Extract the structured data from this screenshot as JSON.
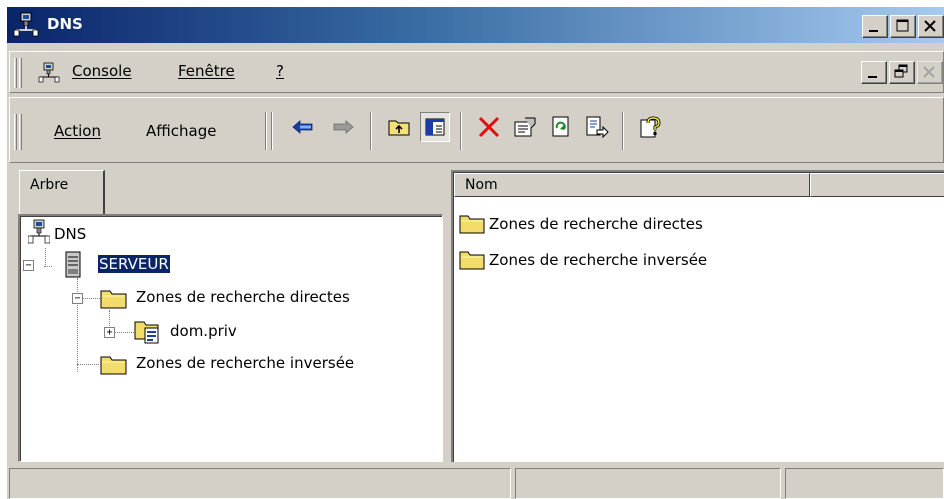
{
  "window": {
    "title": "DNS"
  },
  "menu": {
    "items": [
      "Console",
      "Fenêtre",
      "?"
    ]
  },
  "toolbar": {
    "action_label": "Action",
    "view_label": "Affichage"
  },
  "left_pane": {
    "tab_label": "Arbre",
    "tree": {
      "root": "DNS",
      "server": "SERVEUR",
      "forward_zones": "Zones de recherche directes",
      "zone_domain": "dom.priv",
      "reverse_zones": "Zones de recherche inversée"
    }
  },
  "right_pane": {
    "column_name": "Nom",
    "items": [
      "Zones de recherche directes",
      "Zones de recherche inversée"
    ]
  },
  "colors": {
    "title_active": "#0a246a",
    "selection": "#0a246a",
    "face": "#d4d0c8"
  },
  "icons": [
    "dns-console-icon",
    "server-icon",
    "folder-icon",
    "zone-icon",
    "back-arrow-icon",
    "forward-arrow-icon",
    "up-folder-icon",
    "show-tree-icon",
    "delete-icon",
    "properties-icon",
    "refresh-icon",
    "export-list-icon",
    "help-icon"
  ]
}
